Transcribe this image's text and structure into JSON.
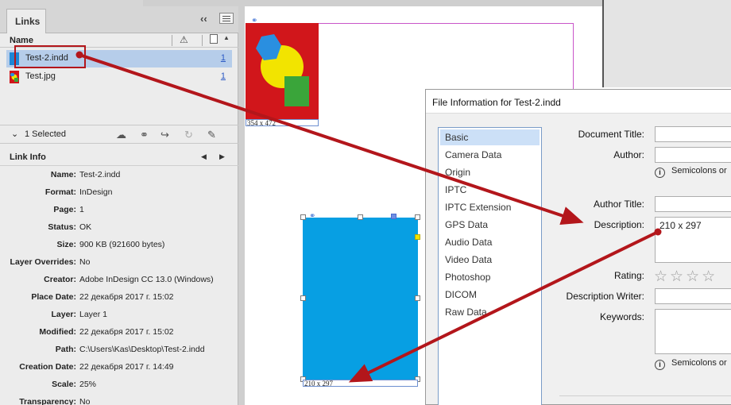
{
  "links_panel": {
    "tab_label": "Links",
    "column_name": "Name",
    "links": [
      {
        "name": "Test-2.indd",
        "page": "1",
        "thumb_color": "#1e86d6"
      },
      {
        "name": "Test.jpg",
        "page": "1",
        "thumb_color": "#d1161b"
      }
    ],
    "selection_text": "1 Selected",
    "link_info_title": "Link Info",
    "info": [
      {
        "label": "Name:",
        "value": "Test-2.indd"
      },
      {
        "label": "Format:",
        "value": "InDesign"
      },
      {
        "label": "Page:",
        "value": "1"
      },
      {
        "label": "Status:",
        "value": "OK"
      },
      {
        "label": "Size:",
        "value": "900 KB (921600 bytes)"
      },
      {
        "label": "Layer Overrides:",
        "value": "No"
      },
      {
        "label": "Creator:",
        "value": "Adobe InDesign CC 13.0 (Windows)"
      },
      {
        "label": "Place Date:",
        "value": "22 декабря 2017 г. 15:02"
      },
      {
        "label": "Layer:",
        "value": "Layer 1"
      },
      {
        "label": "Modified:",
        "value": "22 декабря 2017 г. 15:02"
      },
      {
        "label": "Path:",
        "value": "C:\\Users\\Kas\\Desktop\\Test-2.indd"
      },
      {
        "label": "Creation Date:",
        "value": "22 декабря 2017 г. 14:49"
      },
      {
        "label": "Scale:",
        "value": "25%"
      },
      {
        "label": "Transparency:",
        "value": "No"
      }
    ]
  },
  "canvas": {
    "image1_caption": "354 x 472",
    "frame2_caption": "210 x 297",
    "frame2_color": "#079fe3",
    "image1_bg": "#d1161b"
  },
  "dialog": {
    "title": "File Information for Test-2.indd",
    "categories": [
      "Basic",
      "Camera Data",
      "Origin",
      "IPTC",
      "IPTC Extension",
      "GPS Data",
      "Audio Data",
      "Video Data",
      "Photoshop",
      "DICOM",
      "Raw Data"
    ],
    "active_category": "Basic",
    "fields": {
      "document_title": {
        "label": "Document Title:",
        "value": ""
      },
      "author": {
        "label": "Author:",
        "value": ""
      },
      "author_hint": "Semicolons or",
      "author_title": {
        "label": "Author Title:",
        "value": ""
      },
      "description": {
        "label": "Description:",
        "value": "210 x 297"
      },
      "rating": {
        "label": "Rating:",
        "stars": "☆☆☆☆"
      },
      "description_writer": {
        "label": "Description Writer:",
        "value": ""
      },
      "keywords": {
        "label": "Keywords:",
        "value": ""
      },
      "keywords_hint": "Semicolons or"
    }
  },
  "colors": {
    "annotation_red": "#b3161b",
    "selection": "#b6cdea"
  }
}
